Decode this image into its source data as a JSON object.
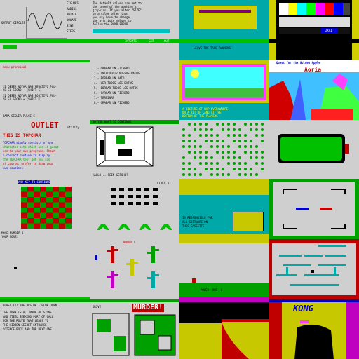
{
  "tiles": {
    "r1c1": {
      "lines": [
        "FIGURES",
        "RADIUS",
        "ROTATE",
        "NOWAVE",
        "SINE",
        "STEPS",
        "OUTPUT CIRCLES"
      ]
    },
    "r1c2": {
      "lines": [
        "The default values are set to",
        "the speed of the machine's",
        "graphics. If you alter \"SIZE\"",
        "to a value other than",
        "you may have to change",
        "the attribute values to",
        "follow the RAMP ERROR"
      ],
      "menu": [
        "INTENTS",
        "EXT",
        "OUT"
      ]
    },
    "r1c3": {
      "caption": "LEAVE THE TAPE RUNNING"
    },
    "r1c4": {
      "badge": "ZXAI",
      "colors": [
        "#ffffff",
        "#ffff00",
        "#00ffff",
        "#00ff00",
        "#ff00ff",
        "#ff0000",
        "#0000ff",
        "#000000"
      ]
    },
    "r2c1": {
      "heading": "menu principal",
      "lines": [
        "SI DESEA NOTAR MAS NEGATIVO PUL-",
        "SE EL SIGNO - (SHIFT S)",
        "SI DESEA NOTAR MAS POSITIVO PUL-",
        "SE EL SIGNO + (SHIFT K)"
      ],
      "footer": "PARA SEGUIR PULSE C"
    },
    "r2c2": {
      "items": [
        "1.- GRABAR UN FICHERO",
        "2.- INTRODUCIR NUEVOS DATOS",
        "3.- BORRAR UN DATO",
        "4.- VER TODOS LOS DATOS",
        "5.- BORRAR TODOS LOS DATOS",
        "6.- CARGAR UN FICHERO",
        "7.- TERMINAR",
        "8.- GRABAR UN FICHERO"
      ]
    },
    "r2c3": {
      "lines": [
        "A PICTURE OF NAP EVERYWHERE",
        "ON A BIT OF LAND AT THE",
        "BOTTOM OF THE PLAYERS"
      ]
    },
    "r2c4": {
      "title_line1": "Quest for the Golden Apple",
      "title_line2": "Aoria"
    },
    "r3c1": {
      "logo": "OUTLET",
      "logo_sub": "utility",
      "headline": "THIS IS TOPCHAR",
      "body": [
        "TOPCHAR simply consists of one",
        "character sets which are of great",
        "use to your own programs. Shown",
        "a correct routine to display",
        "the TOPCHAR text but you can",
        "of course, prefer to draw your",
        "own routines"
      ]
    },
    "r3c2": {
      "header": "DO YOU WANT TO CONTINUE",
      "prompt": "HALLO... SEIN GEFOHL?"
    },
    "r3c3": {},
    "r3c4": {},
    "r4c1": {
      "header": "ANY KEY TO CONTINUE",
      "footer": [
        "MOVE NUMBER 0",
        "YOUR MOVE:"
      ]
    },
    "r4c2": {
      "score": "LIVES 3"
    },
    "r4c3": {
      "lines": [
        "IS RESPONSIBLE FOR",
        "ALL SOFTWARE ON",
        "THIS CASSETTE"
      ]
    },
    "r4c4": {},
    "r5c1": {},
    "r5c2": {
      "label": "ROUND 1"
    },
    "r5c3": {
      "score": "POWER  ROT  0"
    },
    "r5c4": {},
    "r6c1": {
      "header": "BLAST IT! THE RESCUE - BLUE DOWN",
      "lines": [
        "THE TOWN IS ALL MADE OF STONE",
        "AND STEEL SEEKING PORT OF CALL",
        "FOR THE ROUTE THAT LEADS TO",
        "THE HIDDEN SECRET ENTRANCE",
        "SCIENCE ROCK AND THE NEXT ONE"
      ]
    },
    "r6c2": {
      "title": "MURDER!",
      "label": "DRIVE"
    },
    "r6c3": {},
    "r6c4": {
      "title": "KONG"
    }
  }
}
